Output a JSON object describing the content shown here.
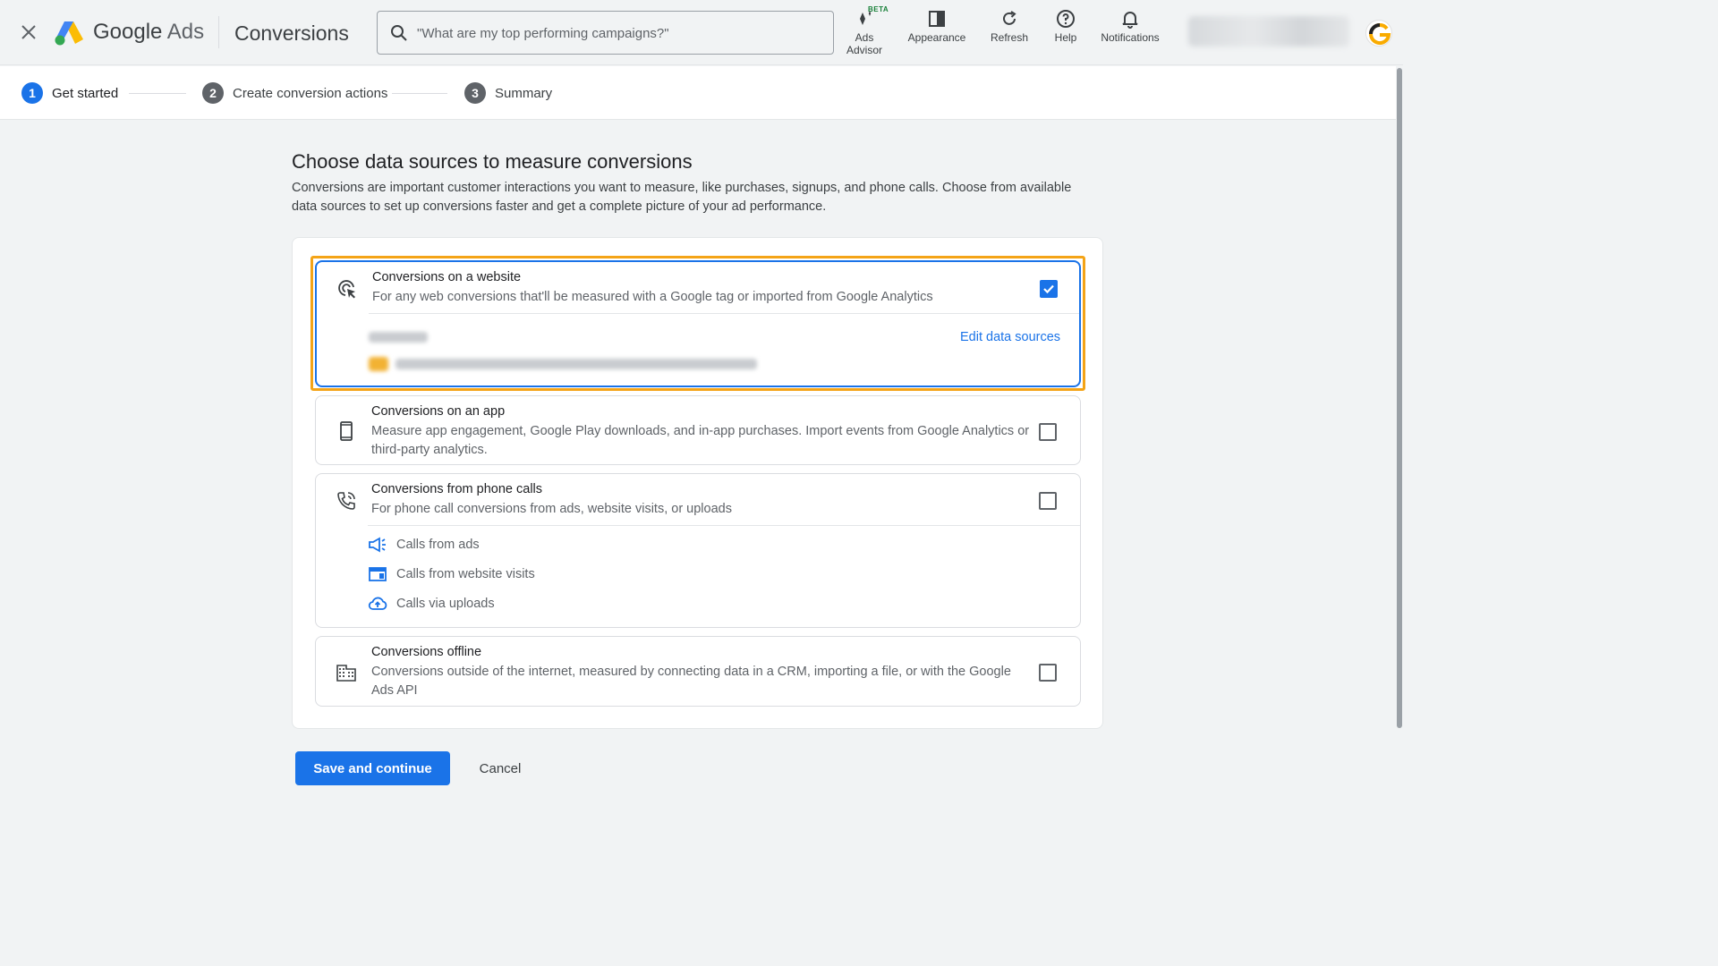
{
  "header": {
    "brand_google": "Google",
    "brand_ads": "Ads",
    "page_title": "Conversions",
    "search_placeholder": "\"What are my top performing campaigns?\"",
    "tools": [
      {
        "label": "Ads",
        "label2": "Advisor",
        "icon": "ads-advisor-icon",
        "badge": "BETA"
      },
      {
        "label": "Appearance",
        "icon": "appearance-icon"
      },
      {
        "label": "Refresh",
        "icon": "refresh-icon"
      },
      {
        "label": "Help",
        "icon": "help-icon"
      },
      {
        "label": "Notifications",
        "icon": "bell-icon"
      }
    ]
  },
  "stepper": {
    "steps": [
      {
        "number": "1",
        "label": "Get started",
        "active": true
      },
      {
        "number": "2",
        "label": "Create conversion actions",
        "active": false
      },
      {
        "number": "3",
        "label": "Summary",
        "active": false
      }
    ]
  },
  "main": {
    "heading": "Choose data sources to measure conversions",
    "intro": "Conversions are important customer interactions you want to measure, like purchases, signups, and phone calls. Choose from available data sources to set up conversions faster and get a complete picture of your ad performance.",
    "options": [
      {
        "title": "Conversions on a website",
        "description": "For any web conversions that'll be measured with a Google tag or imported from Google Analytics",
        "checked": true,
        "edit_link": "Edit data sources"
      },
      {
        "title": "Conversions on an app",
        "description": "Measure app engagement, Google Play downloads, and in-app purchases. Import events from Google Analytics or third-party analytics.",
        "checked": false
      },
      {
        "title": "Conversions from phone calls",
        "description": "For phone call conversions from ads, website visits, or uploads",
        "checked": false,
        "sub_items": [
          "Calls from ads",
          "Calls from website visits",
          "Calls via uploads"
        ]
      },
      {
        "title": "Conversions offline",
        "description": "Conversions outside of the internet, measured by connecting data in a CRM, importing a file, or with the Google Ads API",
        "checked": false
      }
    ]
  },
  "footer": {
    "save_label": "Save and continue",
    "cancel_label": "Cancel"
  },
  "colors": {
    "accent": "#1a73e8",
    "highlight": "#f4a417"
  }
}
